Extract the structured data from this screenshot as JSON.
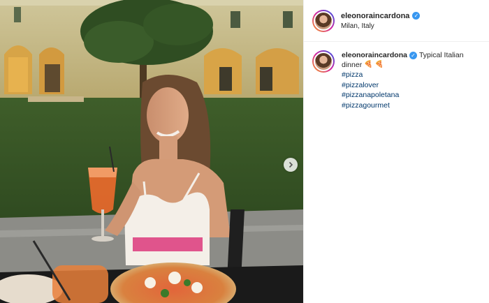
{
  "post": {
    "username": "eleonoraincardona",
    "verified": true,
    "location": "Milan, Italy",
    "caption": {
      "username": "eleonoraincardona",
      "text_line1": "Typical Italian",
      "text_line2": "dinner",
      "emojis": [
        "🍕",
        "🍕"
      ],
      "hashtags": [
        "#pizza",
        "#pizzalover",
        "#pizzanapoletana",
        "#pizzagourmet"
      ]
    }
  },
  "icons": {
    "verified": "verified-badge-icon",
    "next": "chevron-right-icon"
  },
  "colors": {
    "hashtag": "#00376b",
    "verified": "#3897f0"
  }
}
